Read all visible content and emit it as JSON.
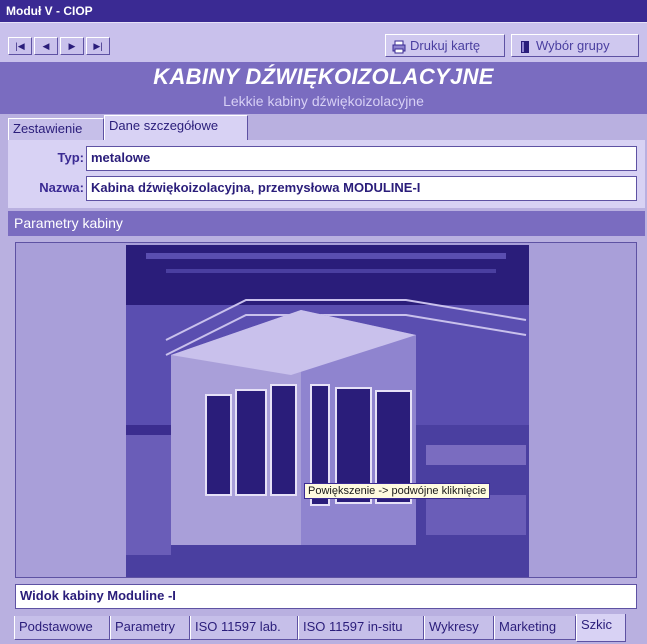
{
  "window": {
    "title": "Moduł V - CIOP"
  },
  "toolbar": {
    "nav": [
      {
        "name": "first-record-button",
        "glyph": "|◀"
      },
      {
        "name": "prev-record-button",
        "glyph": "◀"
      },
      {
        "name": "next-record-button",
        "glyph": "▶"
      },
      {
        "name": "last-record-button",
        "glyph": "▶|"
      }
    ],
    "print_label": "Drukuj kartę",
    "group_label": "Wybór grupy"
  },
  "header": {
    "title": "KABINY DŹWIĘKOIZOLACYJNE",
    "subtitle": "Lekkie kabiny dźwiękoizolacyjne"
  },
  "top_tabs": [
    "Zestawienie",
    "Dane szczegółowe"
  ],
  "fields": {
    "type_label": "Typ:",
    "type_value": "metalowe",
    "name_label": "Nazwa:",
    "name_value": "Kabina dźwiękoizolacyjna, przemysłowa MODULINE-I"
  },
  "section": {
    "title": "Parametry kabiny"
  },
  "image": {
    "tooltip": "Powiększenie -> podwójne kliknięcie",
    "caption": "Widok kabiny Moduline -I"
  },
  "bottom_tabs": [
    "Podstawowe",
    "Parametry",
    "ISO 11597 lab.",
    "ISO 11597 in-situ",
    "Wykresy",
    "Marketing",
    "Szkic"
  ],
  "colors": {
    "title_bar": "#3a2a93",
    "accent": "#7a6cc0",
    "panel": "#b9b0e0"
  }
}
